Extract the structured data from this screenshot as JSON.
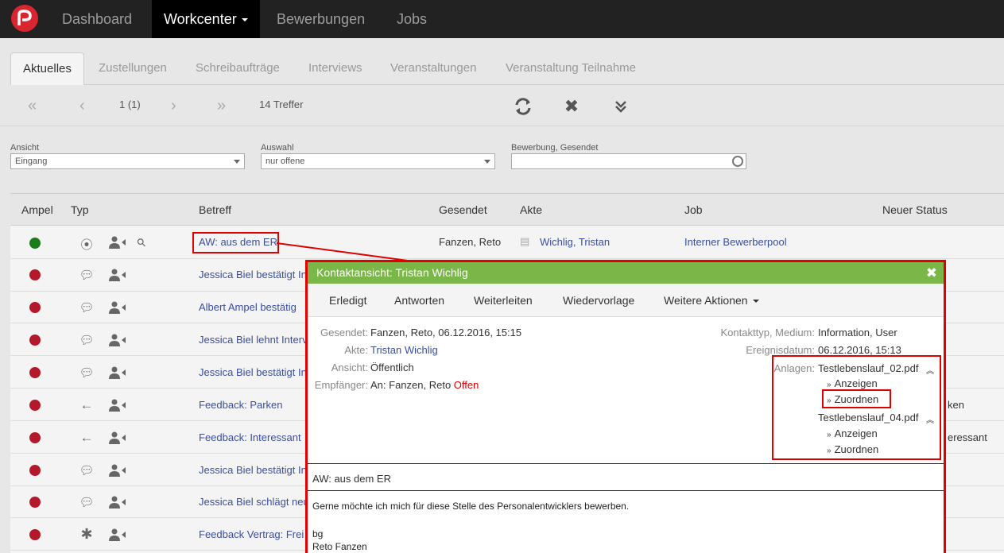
{
  "nav": {
    "items": [
      "Dashboard",
      "Workcenter",
      "Bewerbungen",
      "Jobs"
    ],
    "active": "Workcenter"
  },
  "tabs": [
    "Aktuelles",
    "Zustellungen",
    "Schreibaufträge",
    "Interviews",
    "Veranstaltungen",
    "Veranstaltung Teilnahme"
  ],
  "pager": {
    "page": "1 (1)",
    "hits": "14 Treffer"
  },
  "filters": {
    "ansicht": {
      "label": "Ansicht",
      "value": "Eingang"
    },
    "auswahl": {
      "label": "Auswahl",
      "value": "nur offene"
    },
    "bewerbung": {
      "label": "Bewerbung, Gesendet",
      "value": ""
    }
  },
  "table": {
    "headers": [
      "Ampel",
      "Typ",
      "Betreff",
      "Gesendet",
      "Akte",
      "Job",
      "Neuer Status"
    ],
    "rows": [
      {
        "ampel": "green",
        "typ": "target",
        "betreff": "AW: aus dem ER",
        "gesendet": "Fanzen, Reto",
        "akte": "Wichlig, Tristan",
        "job": "Interner Bewerberpool",
        "status": ""
      },
      {
        "ampel": "red",
        "typ": "comment",
        "betreff": "Jessica Biel bestätigt In",
        "status": ""
      },
      {
        "ampel": "red",
        "typ": "comment",
        "betreff": "Albert Ampel bestätig",
        "status": ""
      },
      {
        "ampel": "red",
        "typ": "comment",
        "betreff": "Jessica Biel lehnt Interv",
        "status": ""
      },
      {
        "ampel": "red",
        "typ": "comment",
        "betreff": "Jessica Biel bestätigt In",
        "status": ""
      },
      {
        "ampel": "red",
        "typ": "arrow-left",
        "betreff": "Feedback: Parken",
        "status": "ken"
      },
      {
        "ampel": "red",
        "typ": "arrow-left",
        "betreff": "Feedback: Interessant",
        "status": "eressant"
      },
      {
        "ampel": "red",
        "typ": "comment",
        "betreff": "Jessica Biel bestätigt In",
        "status": ""
      },
      {
        "ampel": "red",
        "typ": "comment",
        "betreff": "Jessica Biel schlägt neu",
        "status": ""
      },
      {
        "ampel": "red",
        "typ": "asterisk",
        "betreff": "Feedback Vertrag: Frei",
        "status": ""
      }
    ]
  },
  "modal": {
    "title": "Kontaktansicht: Tristan Wichlig",
    "actions": [
      "Erledigt",
      "Antworten",
      "Weiterleiten",
      "Wiedervorlage",
      "Weitere Aktionen"
    ],
    "fields": {
      "gesendet": {
        "label": "Gesendet:",
        "value": "Fanzen, Reto, 06.12.2016, 15:15"
      },
      "akte": {
        "label": "Akte:",
        "value": "Tristan Wichlig"
      },
      "ansicht": {
        "label": "Ansicht:",
        "value": "Öffentlich"
      },
      "empfaenger": {
        "label": "Empfänger:",
        "value": "An: Fanzen, Reto",
        "status": "Offen"
      },
      "kontakttyp": {
        "label": "Kontakttyp, Medium:",
        "value": "Information, User"
      },
      "ereignisdatum": {
        "label": "Ereignisdatum:",
        "value": "06.12.2016, 15:13"
      },
      "anlagen": {
        "label": "Anlagen:"
      }
    },
    "attachments": [
      {
        "name": "Testlebenslauf_02.pdf",
        "actions": [
          "Anzeigen",
          "Zuordnen"
        ]
      },
      {
        "name": "Testlebenslauf_04.pdf",
        "actions": [
          "Anzeigen",
          "Zuordnen"
        ]
      }
    ],
    "subject": "AW: aus dem ER",
    "body": [
      "Gerne möchte ich mich für diese Stelle des Personalentwicklers bewerben.",
      "bg",
      "Reto Fanzen"
    ]
  },
  "colors": {
    "nav_bg": "#222222",
    "header_green": "#7ab648",
    "highlight_red": "#e00000",
    "link_blue": "#3a4fa0",
    "ampel_red": "#b5172b",
    "ampel_green": "#1a7d1a"
  }
}
